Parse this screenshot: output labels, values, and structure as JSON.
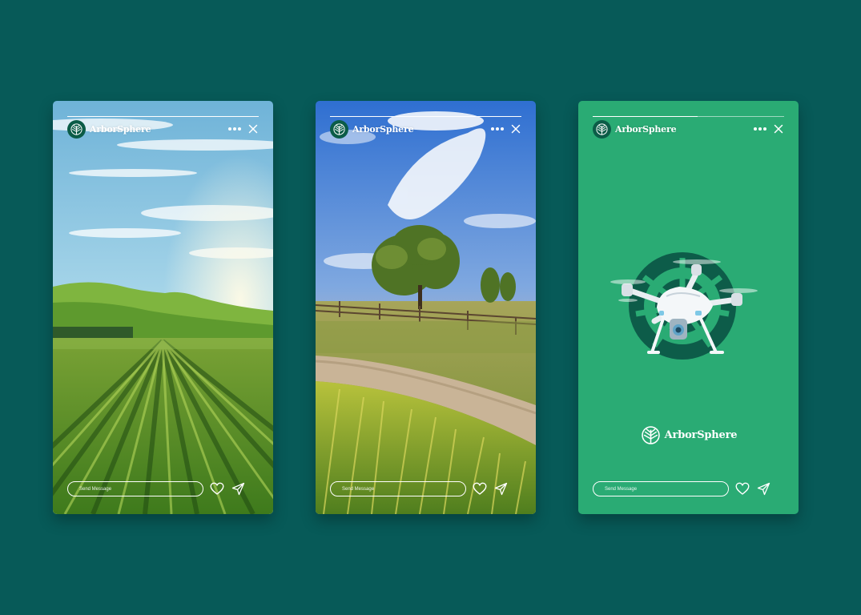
{
  "stories": [
    {
      "id": "vineyard",
      "scene": "vineyard-scene",
      "brand": "ArborSphere",
      "progress": 1.0,
      "message_placeholder": "Send Message"
    },
    {
      "id": "field",
      "scene": "field-scene",
      "brand": "ArborSphere",
      "progress": 1.0,
      "message_placeholder": "Send Message"
    },
    {
      "id": "drone",
      "scene": "drone-scene",
      "brand": "ArborSphere",
      "progress": 0.55,
      "message_placeholder": "Send Message",
      "center_logo_text": "ArborSphere"
    }
  ],
  "colors": {
    "page_background": "#075a58",
    "drone_story_background": "#2aab74",
    "brand_dark_green": "#0b5c47",
    "ui_white": "#ffffff"
  },
  "icons": [
    "arborsphere-logo-icon",
    "more-icon",
    "close-icon",
    "heart-icon",
    "send-icon",
    "drone-icon"
  ]
}
